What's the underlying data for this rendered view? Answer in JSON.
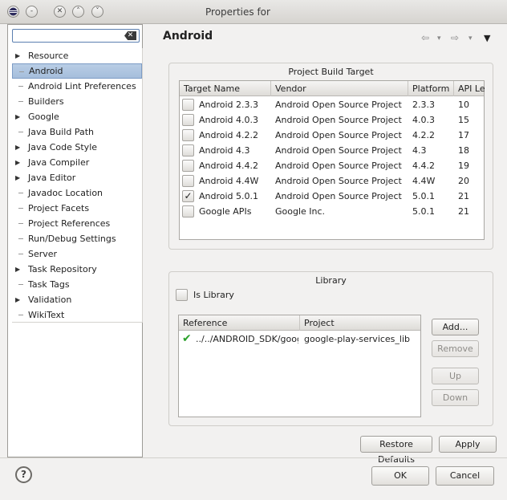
{
  "window": {
    "title": "Properties for ",
    "menu_icon": "eclipse-menu-icon"
  },
  "search": {
    "value": "",
    "placeholder": ""
  },
  "tree": {
    "items": [
      {
        "label": "Resource",
        "expandable": true
      },
      {
        "label": "Android",
        "expandable": false,
        "selected": true
      },
      {
        "label": "Android Lint Preferences",
        "expandable": false
      },
      {
        "label": "Builders",
        "expandable": false
      },
      {
        "label": "Google",
        "expandable": true
      },
      {
        "label": "Java Build Path",
        "expandable": false
      },
      {
        "label": "Java Code Style",
        "expandable": true
      },
      {
        "label": "Java Compiler",
        "expandable": true
      },
      {
        "label": "Java Editor",
        "expandable": true
      },
      {
        "label": "Javadoc Location",
        "expandable": false
      },
      {
        "label": "Project Facets",
        "expandable": false
      },
      {
        "label": "Project References",
        "expandable": false
      },
      {
        "label": "Run/Debug Settings",
        "expandable": false
      },
      {
        "label": "Server",
        "expandable": false
      },
      {
        "label": "Task Repository",
        "expandable": true
      },
      {
        "label": "Task Tags",
        "expandable": false
      },
      {
        "label": "Validation",
        "expandable": true
      },
      {
        "label": "WikiText",
        "expandable": false
      }
    ]
  },
  "page": {
    "title": "Android"
  },
  "build_target": {
    "title": "Project Build Target",
    "columns": [
      "Target Name",
      "Vendor",
      "Platform",
      "API Le"
    ],
    "rows": [
      {
        "name": "Android 2.3.3",
        "vendor": "Android Open Source Project",
        "platform": "2.3.3",
        "api": "10",
        "checked": false
      },
      {
        "name": "Android 4.0.3",
        "vendor": "Android Open Source Project",
        "platform": "4.0.3",
        "api": "15",
        "checked": false
      },
      {
        "name": "Android 4.2.2",
        "vendor": "Android Open Source Project",
        "platform": "4.2.2",
        "api": "17",
        "checked": false
      },
      {
        "name": "Android 4.3",
        "vendor": "Android Open Source Project",
        "platform": "4.3",
        "api": "18",
        "checked": false
      },
      {
        "name": "Android 4.4.2",
        "vendor": "Android Open Source Project",
        "platform": "4.4.2",
        "api": "19",
        "checked": false
      },
      {
        "name": "Android 4.4W",
        "vendor": "Android Open Source Project",
        "platform": "4.4W",
        "api": "20",
        "checked": false
      },
      {
        "name": "Android 5.0.1",
        "vendor": "Android Open Source Project",
        "platform": "5.0.1",
        "api": "21",
        "checked": true
      },
      {
        "name": "Google APIs",
        "vendor": "Google Inc.",
        "platform": "5.0.1",
        "api": "21",
        "checked": false
      }
    ]
  },
  "library": {
    "title": "Library",
    "is_library_label": "Is Library",
    "is_library_checked": false,
    "columns": [
      "Reference",
      "Project"
    ],
    "rows": [
      {
        "reference": "../../ANDROID_SDK/google",
        "project": "google-play-services_lib",
        "ok": true
      }
    ],
    "buttons": {
      "add": "Add...",
      "remove": "Remove",
      "up": "Up",
      "down": "Down"
    }
  },
  "footer": {
    "restore_defaults": "Restore Defaults",
    "apply": "Apply",
    "ok": "OK",
    "cancel": "Cancel"
  }
}
